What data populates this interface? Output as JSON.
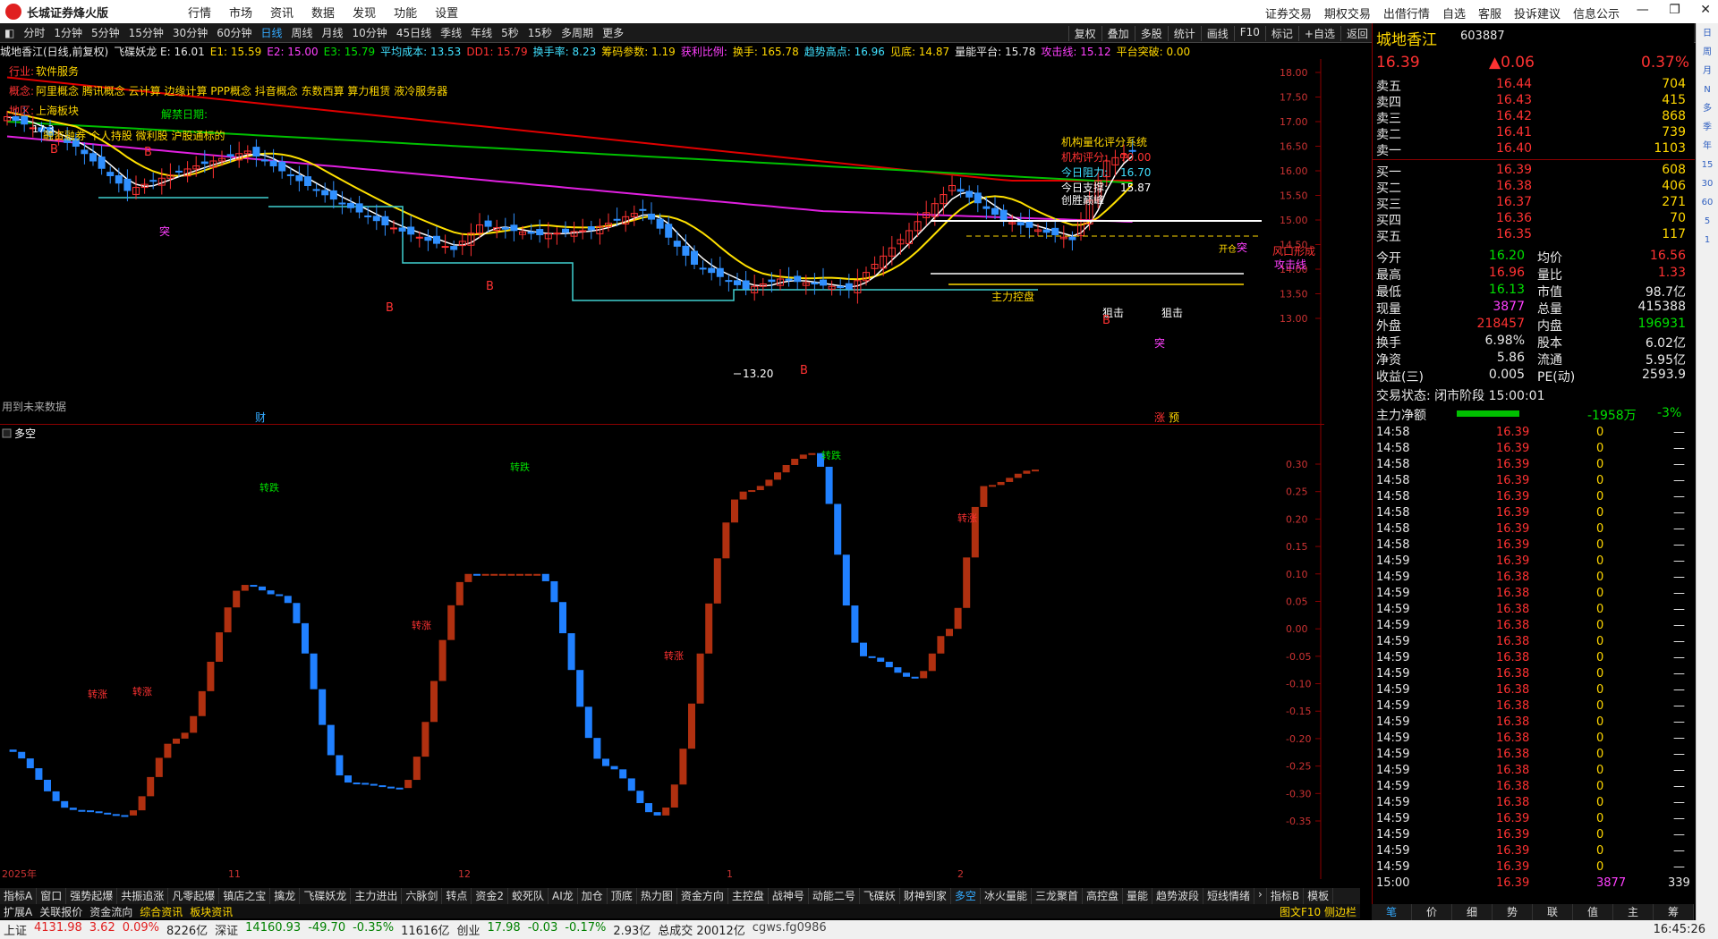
{
  "app": {
    "name": "长城证券烽火版",
    "menu": [
      "行情",
      "市场",
      "资讯",
      "数据",
      "发现",
      "功能",
      "设置"
    ],
    "right_menu": [
      "证券交易",
      "期权交易",
      "出借行情",
      "自选",
      "客服",
      "投诉建议",
      "信息公示"
    ]
  },
  "periods": [
    "分时",
    "1分钟",
    "5分钟",
    "15分钟",
    "30分钟",
    "60分钟",
    "日线",
    "周线",
    "月线",
    "10分钟",
    "45日线",
    "季线",
    "年线",
    "5秒",
    "15秒",
    "多周期",
    "更多"
  ],
  "active_period": "日线",
  "toolbar_right": [
    "复权",
    "叠加",
    "多股",
    "统计",
    "画线",
    "F10",
    "标记",
    "+自选",
    "返回"
  ],
  "indicator_line": [
    {
      "t": "城地香江(日线,前复权)",
      "c": "#e8e8e8"
    },
    {
      "t": "飞碟妖龙 E: 16.01",
      "c": "#e8e8e8"
    },
    {
      "t": "E1: 15.59",
      "c": "#ffd700"
    },
    {
      "t": "E2: 15.00",
      "c": "#ff40ff"
    },
    {
      "t": "E3: 15.79",
      "c": "#00e000"
    },
    {
      "t": "平均成本: 13.53",
      "c": "#40e0ff"
    },
    {
      "t": "DD1: 15.79",
      "c": "#ff3232"
    },
    {
      "t": "换手率: 8.23",
      "c": "#40e0ff"
    },
    {
      "t": "筹码参数: 1.19",
      "c": "#ffd700"
    },
    {
      "t": "获利比例:",
      "c": "#ff40ff"
    },
    {
      "t": "换手: 165.78",
      "c": "#ffd700"
    },
    {
      "t": "趋势高点: 16.96",
      "c": "#40e0ff"
    },
    {
      "t": "见底: 14.87",
      "c": "#ffd700"
    },
    {
      "t": "量能平台: 15.78",
      "c": "#e8e8e8"
    },
    {
      "t": "攻击线: 15.12",
      "c": "#ff40ff"
    },
    {
      "t": "平台突破: 0.00",
      "c": "#ffd700"
    }
  ],
  "annotations": {
    "industry_label": "行业:",
    "industry": "软件服务",
    "concept_label": "概念:",
    "concepts": "阿里概念 腾讯概念 云计算 边缘计算 PPP概念 抖音概念 东数西算 算力租赁 液冷服务器",
    "region_label": "地区:",
    "region": "上海板块",
    "margin": "融资融券 个人持股 微利股 沪股通标的",
    "margin_prefix": "17.3",
    "unlock": "解禁日期:",
    "future_data": "用到未来数据",
    "cai": "财",
    "zhang": "涨",
    "yu": "预"
  },
  "score_box": {
    "title": "机构量化评分系统",
    "score_label": "机构评分:",
    "score": "70.00",
    "resist_label": "今日阻力:",
    "resist": "16.70",
    "support_label": "今日支撑:",
    "support": "15.87",
    "peak": "创胜巅峰"
  },
  "chart_labels": {
    "low_price": "13.20",
    "fengkou": "风口形成",
    "gongji": "攻击线",
    "tu": "突",
    "zhuli": "主力控盘",
    "ju": "狙击",
    "b": "B",
    "kaijia": "开仓"
  },
  "main_axis": [
    "18.00",
    "17.50",
    "17.00",
    "16.50",
    "16.00",
    "15.50",
    "15.00",
    "14.50",
    "14.00",
    "13.50",
    "13.00"
  ],
  "sub_title": "多空",
  "sub_axis": [
    "0.30",
    "0.25",
    "0.20",
    "0.15",
    "0.10",
    "0.05",
    "0.00",
    "-0.05",
    "-0.10",
    "-0.15",
    "-0.20",
    "-0.25",
    "-0.30",
    "-0.35"
  ],
  "sub_labels": {
    "zhuandie": "转跌",
    "zhuanzhang": "转涨"
  },
  "x_axis": [
    "2025年",
    "11",
    "12",
    "1",
    "2"
  ],
  "bottom_period": "日线",
  "tabs": [
    "指标A",
    "窗口",
    "强势起爆",
    "共振追涨",
    "凡零起爆",
    "镇店之宝",
    "擒龙",
    "飞碟妖龙",
    "主力进出",
    "六脉剑",
    "转点",
    "资金2",
    "蛟死队",
    "AI龙",
    "加仓",
    "顶底",
    "热力图",
    "资金方向",
    "主控盘",
    "战神号",
    "动能二号",
    "飞碟妖",
    "财神到家",
    "多空",
    "冰火量能",
    "三龙聚首",
    "高控盘",
    "量能",
    "趋势波段",
    "短线情绪"
  ],
  "active_tab": "多空",
  "tabs_right": [
    "指标B",
    "模板"
  ],
  "tabs2": [
    "扩展A",
    "关联报价",
    "资金流向",
    "综合资讯",
    "板块资讯"
  ],
  "tabs2_right": "图文F10 侧边栏",
  "stock": {
    "name": "城地香江",
    "code": "603887",
    "price": "16.39",
    "change": "▲0.06",
    "pct": "0.37%"
  },
  "sell": [
    {
      "l": "卖五",
      "p": "16.44",
      "v": "704"
    },
    {
      "l": "卖四",
      "p": "16.43",
      "v": "415"
    },
    {
      "l": "卖三",
      "p": "16.42",
      "v": "868"
    },
    {
      "l": "卖二",
      "p": "16.41",
      "v": "739"
    },
    {
      "l": "卖一",
      "p": "16.40",
      "v": "1103"
    }
  ],
  "buy": [
    {
      "l": "买一",
      "p": "16.39",
      "v": "608"
    },
    {
      "l": "买二",
      "p": "16.38",
      "v": "406"
    },
    {
      "l": "买三",
      "p": "16.37",
      "v": "271"
    },
    {
      "l": "买四",
      "p": "16.36",
      "v": "70"
    },
    {
      "l": "买五",
      "p": "16.35",
      "v": "117"
    }
  ],
  "quote": [
    {
      "a": "今开",
      "av": "16.20",
      "ac": "green",
      "b": "均价",
      "bv": "16.56",
      "bc": "red"
    },
    {
      "a": "最高",
      "av": "16.96",
      "ac": "red",
      "b": "量比",
      "bv": "1.33",
      "bc": "red"
    },
    {
      "a": "最低",
      "av": "16.13",
      "ac": "green",
      "b": "市值",
      "bv": "98.7亿",
      "bc": "white"
    },
    {
      "a": "现量",
      "av": "3877",
      "ac": "mag",
      "b": "总量",
      "bv": "415388",
      "bc": "white"
    },
    {
      "a": "外盘",
      "av": "218457",
      "ac": "red",
      "b": "内盘",
      "bv": "196931",
      "bc": "green"
    },
    {
      "a": "换手",
      "av": "6.98%",
      "ac": "white",
      "b": "股本",
      "bv": "6.02亿",
      "bc": "white"
    },
    {
      "a": "净资",
      "av": "5.86",
      "ac": "white",
      "b": "流通",
      "bv": "5.95亿",
      "bc": "white"
    },
    {
      "a": "收益(三)",
      "av": "0.005",
      "ac": "white",
      "b": "PE(动)",
      "bv": "2593.9",
      "bc": "white"
    }
  ],
  "trade_status": "交易状态: 闭市阶段 15:00:01",
  "main_flow": {
    "label": "主力净额",
    "value": "-1958万",
    "pct": "-3%"
  },
  "ticks": [
    {
      "t": "14:58",
      "p": "16.39",
      "v": "0"
    },
    {
      "t": "14:58",
      "p": "16.39",
      "v": "0"
    },
    {
      "t": "14:58",
      "p": "16.39",
      "v": "0"
    },
    {
      "t": "14:58",
      "p": "16.39",
      "v": "0"
    },
    {
      "t": "14:58",
      "p": "16.39",
      "v": "0"
    },
    {
      "t": "14:58",
      "p": "16.39",
      "v": "0"
    },
    {
      "t": "14:58",
      "p": "16.39",
      "v": "0"
    },
    {
      "t": "14:58",
      "p": "16.39",
      "v": "0"
    },
    {
      "t": "14:59",
      "p": "16.39",
      "v": "0"
    },
    {
      "t": "14:59",
      "p": "16.38",
      "v": "0"
    },
    {
      "t": "14:59",
      "p": "16.38",
      "v": "0"
    },
    {
      "t": "14:59",
      "p": "16.38",
      "v": "0"
    },
    {
      "t": "14:59",
      "p": "16.38",
      "v": "0"
    },
    {
      "t": "14:59",
      "p": "16.38",
      "v": "0"
    },
    {
      "t": "14:59",
      "p": "16.38",
      "v": "0"
    },
    {
      "t": "14:59",
      "p": "16.38",
      "v": "0"
    },
    {
      "t": "14:59",
      "p": "16.38",
      "v": "0"
    },
    {
      "t": "14:59",
      "p": "16.38",
      "v": "0"
    },
    {
      "t": "14:59",
      "p": "16.38",
      "v": "0"
    },
    {
      "t": "14:59",
      "p": "16.38",
      "v": "0"
    },
    {
      "t": "14:59",
      "p": "16.38",
      "v": "0"
    },
    {
      "t": "14:59",
      "p": "16.38",
      "v": "0"
    },
    {
      "t": "14:59",
      "p": "16.38",
      "v": "0"
    },
    {
      "t": "14:59",
      "p": "16.38",
      "v": "0"
    },
    {
      "t": "14:59",
      "p": "16.39",
      "v": "0"
    },
    {
      "t": "14:59",
      "p": "16.39",
      "v": "0"
    },
    {
      "t": "14:59",
      "p": "16.39",
      "v": "0"
    },
    {
      "t": "14:59",
      "p": "16.39",
      "v": "0"
    },
    {
      "t": "15:00",
      "p": "16.39",
      "v": "3877",
      "v2": "339"
    }
  ],
  "rp_bottom_tabs": [
    "笔",
    "价",
    "细",
    "势",
    "联",
    "值",
    "主",
    "筹"
  ],
  "status": [
    {
      "t": "上证",
      "c": "#222"
    },
    {
      "t": "4131.98",
      "c": "#e02020"
    },
    {
      "t": "3.62",
      "c": "#e02020"
    },
    {
      "t": "0.09%",
      "c": "#e02020"
    },
    {
      "t": "8226亿",
      "c": "#222"
    },
    {
      "t": "深证",
      "c": "#222"
    },
    {
      "t": "14160.93",
      "c": "#008000"
    },
    {
      "t": "-49.70",
      "c": "#008000"
    },
    {
      "t": "-0.35%",
      "c": "#008000"
    },
    {
      "t": "11616亿",
      "c": "#222"
    },
    {
      "t": "创业",
      "c": "#222"
    },
    {
      "t": "17.98",
      "c": "#008000"
    },
    {
      "t": "-0.03",
      "c": "#008000"
    },
    {
      "t": "-0.17%",
      "c": "#008000"
    },
    {
      "t": "2.93亿",
      "c": "#222"
    },
    {
      "t": "总成交 20012亿",
      "c": "#222"
    },
    {
      "t": "cgws.fg0986",
      "c": "#444"
    }
  ],
  "clock": "16:45:26",
  "sidebar": [
    "日",
    "周",
    "月",
    "N",
    "多",
    "季",
    "年",
    "15",
    "30",
    "60",
    "5",
    "1"
  ]
}
